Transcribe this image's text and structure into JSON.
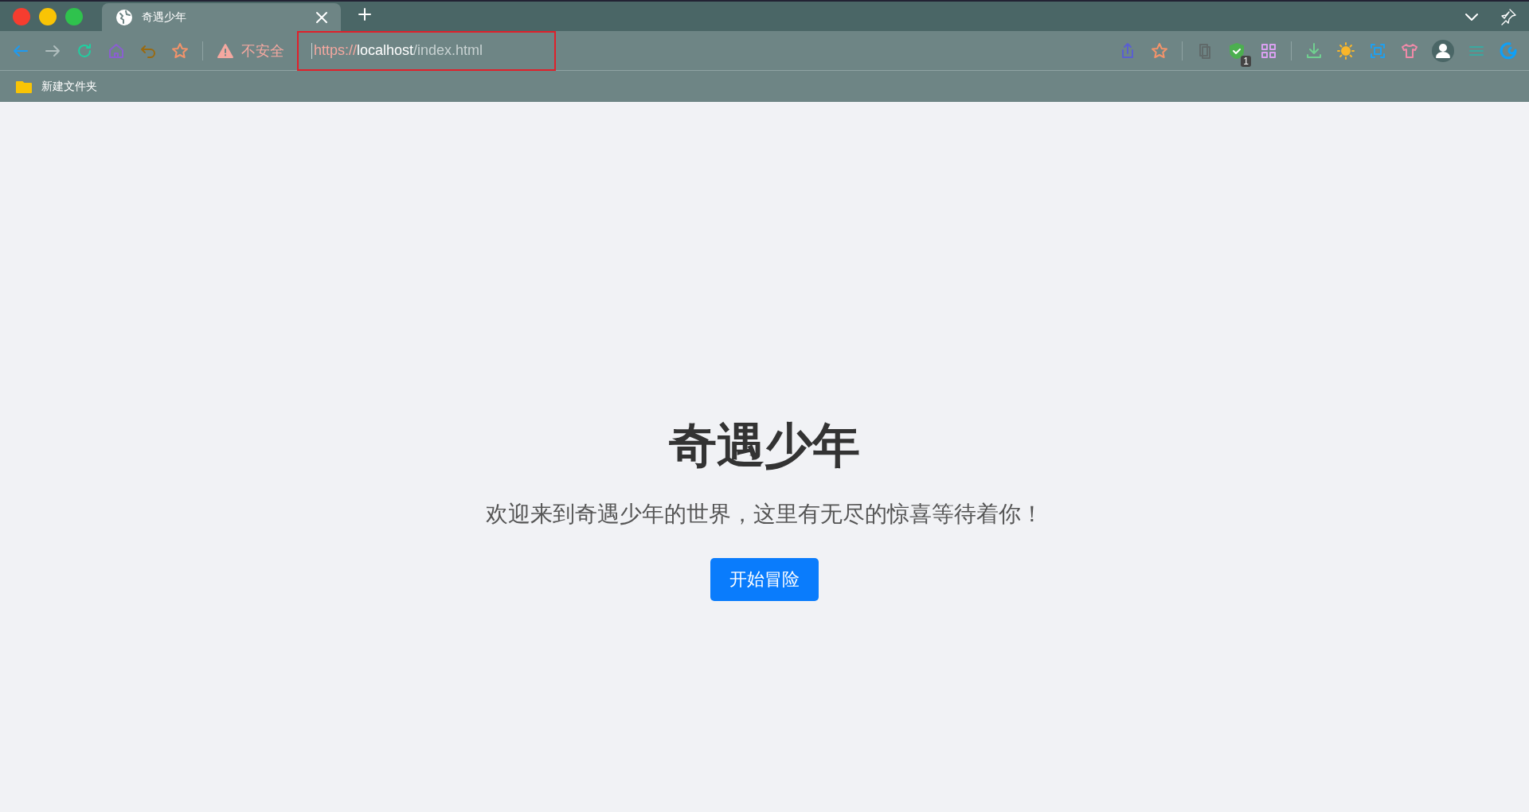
{
  "tabs": [
    {
      "title": "奇遇少年",
      "selected": true
    }
  ],
  "toolbar": {
    "security_label": "不安全",
    "url": {
      "scheme": "https://",
      "host": "localhost",
      "path": "/index.html"
    },
    "highlighted": true,
    "extension_badge": "1"
  },
  "bookmarks": [
    {
      "label": "新建文件夹"
    }
  ],
  "page": {
    "title": "奇遇少年",
    "subtitle": "欢迎来到奇遇少年的世界，这里有无尽的惊喜等待着你！",
    "button": "开始冒险"
  }
}
